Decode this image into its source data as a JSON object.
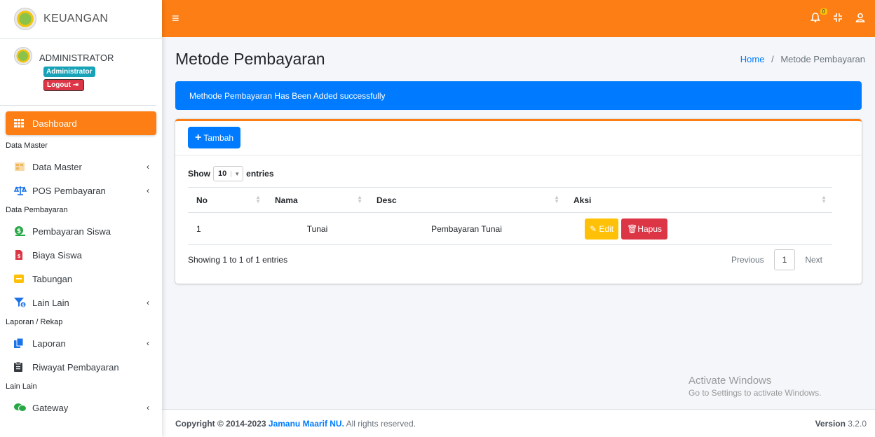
{
  "brand": {
    "title": "KEUANGAN"
  },
  "user": {
    "name": "ADMINISTRATOR",
    "role": "Administrator",
    "logout": "Logout"
  },
  "sidebar": {
    "items": [
      {
        "label": "Dashboard",
        "icon": "grid-icon"
      },
      {
        "header": "Data Master"
      },
      {
        "label": "Data Master",
        "icon": "database-icon"
      },
      {
        "label": "POS Pembayaran",
        "icon": "scale-icon"
      },
      {
        "header": "Data Pembayaran"
      },
      {
        "label": "Pembayaran Siswa",
        "icon": "money-icon"
      },
      {
        "label": "Biaya Siswa",
        "icon": "invoice-icon"
      },
      {
        "label": "Tabungan",
        "icon": "wallet-icon"
      },
      {
        "label": "Lain Lain",
        "icon": "filter-money-icon"
      },
      {
        "header": "Laporan / Rekap"
      },
      {
        "label": "Laporan",
        "icon": "copy-icon"
      },
      {
        "label": "Riwayat Pembayaran",
        "icon": "clipboard-icon"
      },
      {
        "header": "Lain Lain"
      },
      {
        "label": "Gateway",
        "icon": "chat-icon"
      }
    ]
  },
  "topbar": {
    "notification_count": "0"
  },
  "page": {
    "title": "Metode Pembayaran",
    "breadcrumb_home": "Home",
    "breadcrumb_sep": "/",
    "breadcrumb_current": "Metode Pembayaran",
    "alert": "Methode Pembayaran Has Been Added successfully",
    "add_button": "Tambah"
  },
  "table": {
    "show_label": "Show",
    "entries_value": "10",
    "entries_label": "entries",
    "headers": [
      "No",
      "Nama",
      "Desc",
      "Aksi"
    ],
    "rows": [
      {
        "no": "1",
        "nama": "Tunai",
        "desc": "Pembayaran Tunai"
      }
    ],
    "edit_label": "Edit",
    "delete_label": "Hapus",
    "info": "Showing 1 to 1 of 1 entries",
    "prev": "Previous",
    "page": "1",
    "next": "Next"
  },
  "watermark": {
    "title": "Activate Windows",
    "subtitle": "Go to Settings to activate Windows."
  },
  "footer": {
    "copyright": "Copyright © 2014-2023",
    "org": "Jamanu Maarif NU.",
    "rights": "All rights reserved.",
    "version_label": "Version",
    "version_value": "3.2.0"
  },
  "colors": {
    "accent": "#fd7e14",
    "primary": "#007bff",
    "danger": "#dc3545",
    "warning": "#ffc107",
    "info": "#17a2b8"
  }
}
